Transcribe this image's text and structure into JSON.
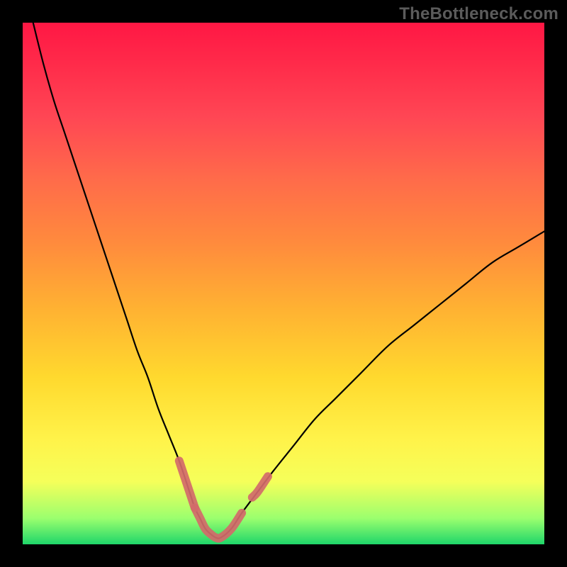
{
  "watermark": "TheBottleneck.com",
  "colors": {
    "curve_stroke": "#000000",
    "highlight_stroke": "#d36a6a",
    "gradient_top": "#ff1744",
    "gradient_bottom": "#1fd66a"
  },
  "chart_data": {
    "type": "line",
    "title": "",
    "xlabel": "",
    "ylabel": "",
    "xlim": [
      0,
      100
    ],
    "ylim": [
      0,
      100
    ],
    "x": [
      2,
      4,
      6,
      8,
      10,
      12,
      14,
      16,
      18,
      20,
      22,
      24,
      26,
      28,
      30,
      32,
      33,
      34,
      35,
      36,
      37,
      38,
      40,
      42,
      45,
      48,
      52,
      56,
      60,
      65,
      70,
      75,
      80,
      85,
      90,
      95,
      100
    ],
    "y": [
      100,
      92,
      85,
      79,
      73,
      67,
      61,
      55,
      49,
      43,
      37,
      32,
      26,
      21,
      16,
      10,
      7,
      5,
      3,
      2,
      1.3,
      1.3,
      3,
      6,
      10,
      14,
      19,
      24,
      28,
      33,
      38,
      42,
      46,
      50,
      54,
      57,
      60
    ],
    "highlight_segments": [
      {
        "x": [
          30,
          32,
          33
        ],
        "y": [
          16,
          10,
          7
        ]
      },
      {
        "x": [
          33,
          34,
          35,
          36,
          37,
          38,
          40,
          42
        ],
        "y": [
          7,
          5,
          3,
          2,
          1.3,
          1.3,
          3,
          6
        ]
      },
      {
        "x": [
          44,
          45,
          47
        ],
        "y": [
          9,
          10,
          13
        ]
      }
    ],
    "grid": false,
    "legend": false
  }
}
